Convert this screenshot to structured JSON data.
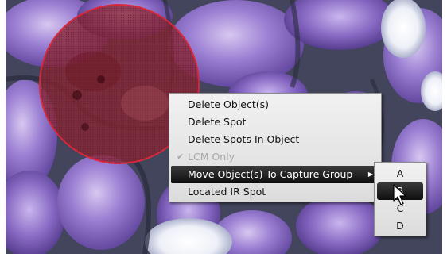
{
  "context_menu": {
    "items": [
      {
        "label": "Delete Object(s)",
        "enabled": true
      },
      {
        "label": "Delete Spot",
        "enabled": true
      },
      {
        "label": "Delete Spots In Object",
        "enabled": true
      },
      {
        "label": "LCM Only",
        "enabled": false,
        "checked": true
      },
      {
        "label": "Move Object(s) To Capture Group",
        "enabled": true,
        "highlighted": true,
        "has_submenu": true
      },
      {
        "label": "Located IR Spot",
        "enabled": true
      }
    ]
  },
  "submenu": {
    "items": [
      {
        "label": "A"
      },
      {
        "label": "B",
        "highlighted": true
      },
      {
        "label": "C"
      },
      {
        "label": "D"
      }
    ]
  },
  "icons": {
    "check": "checkmark-icon",
    "submenu_arrow": "submenu-arrow-icon",
    "cursor": "mouse-pointer-icon"
  },
  "colors": {
    "menu_highlight": "#111111",
    "selection_circle_stroke": "#d8283a",
    "selection_circle_fill": "#8a2533",
    "tissue_purple": "#8b6fc6",
    "stroma_dark": "#3b3e55"
  }
}
